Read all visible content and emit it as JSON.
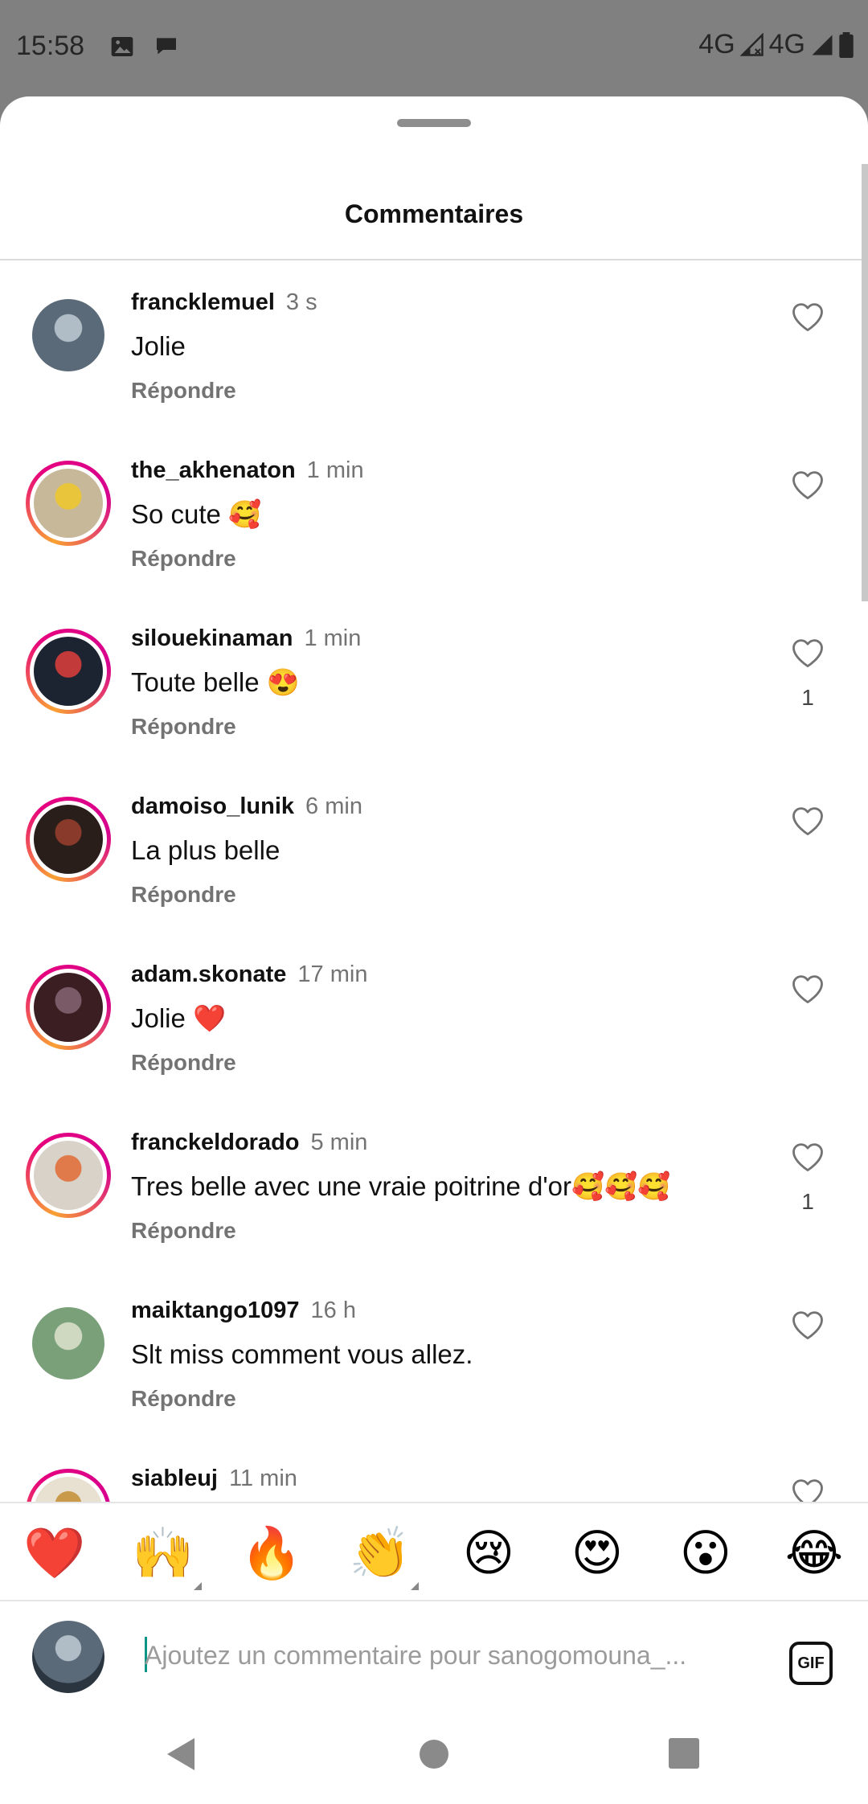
{
  "status_bar": {
    "time": "15:58",
    "network_1": "4G",
    "network_2": "4G"
  },
  "sheet": {
    "title": "Commentaires"
  },
  "comments": [
    {
      "username": "francklemuel",
      "time": "3 s",
      "text": "Jolie",
      "reply": "Répondre",
      "likes": "",
      "ring": false,
      "avatar_colors": [
        "#5a6a78",
        "#b0bcc6"
      ]
    },
    {
      "username": "the_akhenaton",
      "time": "1 min",
      "text": "So cute 🥰",
      "reply": "Répondre",
      "likes": "",
      "ring": true,
      "avatar_colors": [
        "#c7b89a",
        "#e8c53a"
      ]
    },
    {
      "username": "silouekinaman",
      "time": "1 min",
      "text": "Toute belle 😍",
      "reply": "Répondre",
      "likes": "1",
      "ring": true,
      "avatar_colors": [
        "#1b2430",
        "#c23a3a"
      ]
    },
    {
      "username": "damoiso_lunik",
      "time": "6 min",
      "text": "La plus belle",
      "reply": "Répondre",
      "likes": "",
      "ring": true,
      "avatar_colors": [
        "#2a1e1a",
        "#8a3a2a"
      ]
    },
    {
      "username": "adam.skonate",
      "time": "17 min",
      "text": "Jolie ❤️",
      "reply": "Répondre",
      "likes": "",
      "ring": true,
      "avatar_colors": [
        "#3a1e22",
        "#7a5a66"
      ]
    },
    {
      "username": "franckeldorado",
      "time": "5 min",
      "text": "Tres belle avec une vraie poitrine d'or🥰🥰🥰",
      "reply": "Répondre",
      "likes": "1",
      "ring": true,
      "avatar_colors": [
        "#d8d2c8",
        "#e07a4a"
      ]
    },
    {
      "username": "maiktango1097",
      "time": "16 h",
      "text": "Slt miss comment vous allez.",
      "reply": "Répondre",
      "likes": "",
      "ring": false,
      "avatar_colors": [
        "#7aa07a",
        "#cfd8c0"
      ]
    },
    {
      "username": "siableuj",
      "time": "11 min",
      "text": "",
      "reply": "",
      "likes": "",
      "ring": true,
      "avatar_colors": [
        "#e8e0d0",
        "#c89a4a"
      ]
    }
  ],
  "reactions": [
    {
      "icon": "red-heart",
      "glyph": "❤️",
      "has_variants": false
    },
    {
      "icon": "raising-hands",
      "glyph": "🙌",
      "has_variants": true
    },
    {
      "icon": "fire",
      "glyph": "🔥",
      "has_variants": false
    },
    {
      "icon": "clapping-hands",
      "glyph": "👏",
      "has_variants": true
    },
    {
      "icon": "crying-face",
      "glyph": "😢",
      "has_variants": false
    },
    {
      "icon": "heart-eyes-face",
      "glyph": "😍",
      "has_variants": false
    },
    {
      "icon": "surprised-face",
      "glyph": "😮",
      "has_variants": false
    },
    {
      "icon": "tears-of-joy-face",
      "glyph": "😂",
      "has_variants": false
    }
  ],
  "input": {
    "placeholder": "Ajoutez un commentaire pour sanogomouna_...",
    "value": "",
    "gif_label": "GIF"
  }
}
